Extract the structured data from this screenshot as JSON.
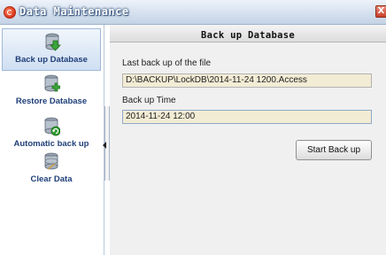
{
  "window": {
    "title": "Data Maintenance",
    "close_label": "X"
  },
  "sidebar": {
    "items": [
      {
        "label": "Back up Database",
        "icon": "database-download-icon",
        "active": true
      },
      {
        "label": "Restore Database",
        "icon": "database-restore-icon",
        "active": false
      },
      {
        "label": "Automatic back up",
        "icon": "database-auto-backup-icon",
        "active": false
      },
      {
        "label": "Clear Data",
        "icon": "database-clear-icon",
        "active": false
      }
    ]
  },
  "panel": {
    "title": "Back up Database",
    "last_backup_label": "Last back up of the file",
    "last_backup_value": "D:\\BACKUP\\LockDB\\2014-11-24 1200.Access",
    "backup_time_label": "Back up Time",
    "backup_time_value": "2014-11-24 12:00",
    "start_button_label": "Start Back up"
  },
  "colors": {
    "accent": "#1f3f79",
    "field_bg": "#f3ecd5",
    "panel_bg": "#f0f0f0"
  }
}
